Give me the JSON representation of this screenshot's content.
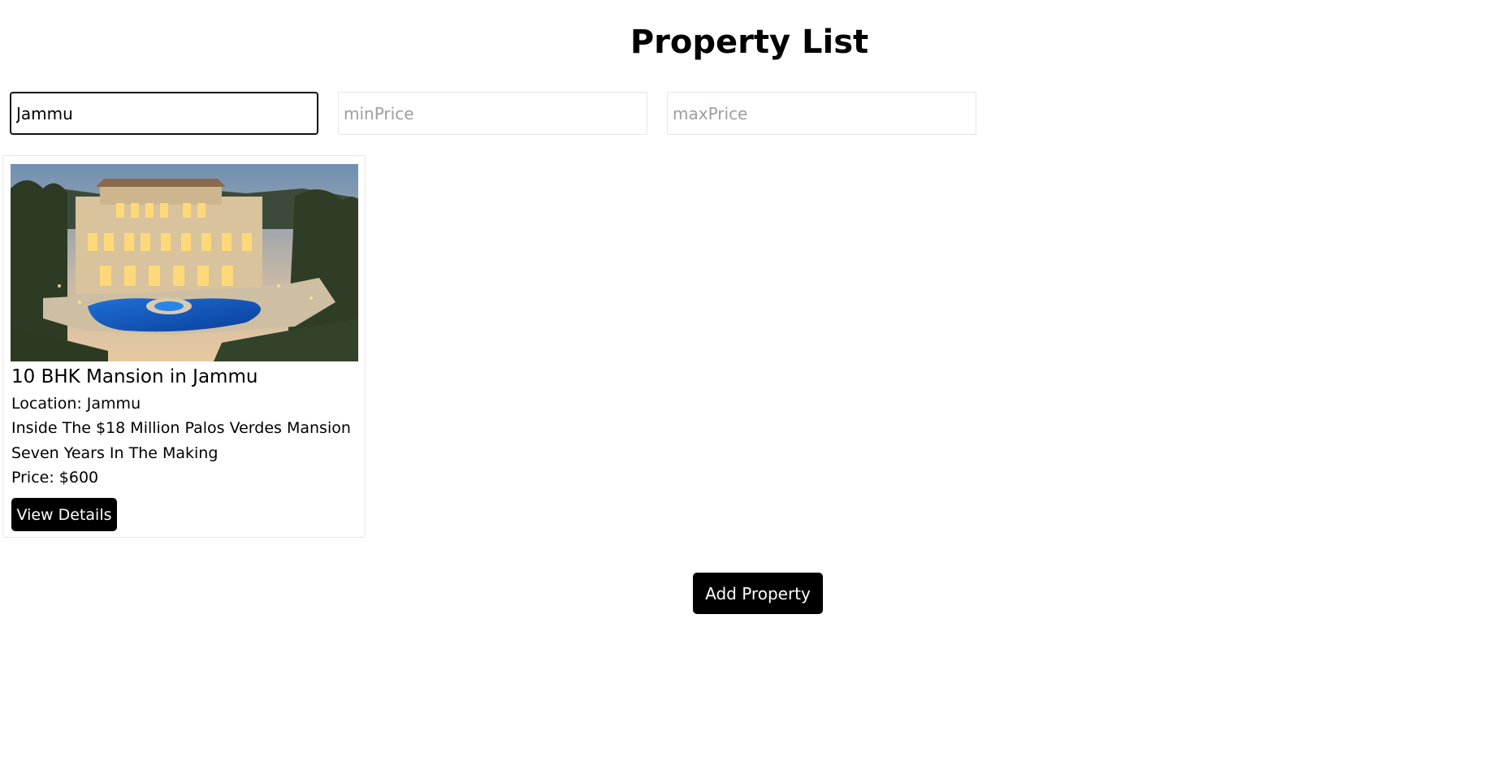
{
  "page": {
    "title": "Property List"
  },
  "filters": {
    "location": {
      "value": "Jammu",
      "placeholder": ""
    },
    "min_price": {
      "value": "",
      "placeholder": "minPrice"
    },
    "max_price": {
      "value": "",
      "placeholder": "maxPrice"
    }
  },
  "properties": [
    {
      "title": "10 BHK Mansion in Jammu",
      "location": "Location: Jammu",
      "description": "Inside The $18 Million Palos Verdes Mansion",
      "description_cont": "Seven Years In The Making",
      "price": "Price: $600",
      "button_label": "View Details"
    }
  ],
  "actions": {
    "add_property_label": "Add Property"
  },
  "colors": {
    "button_bg": "#000000",
    "button_text": "#ffffff",
    "input_border": "#e6e6e6",
    "focused_border": "#111111"
  }
}
